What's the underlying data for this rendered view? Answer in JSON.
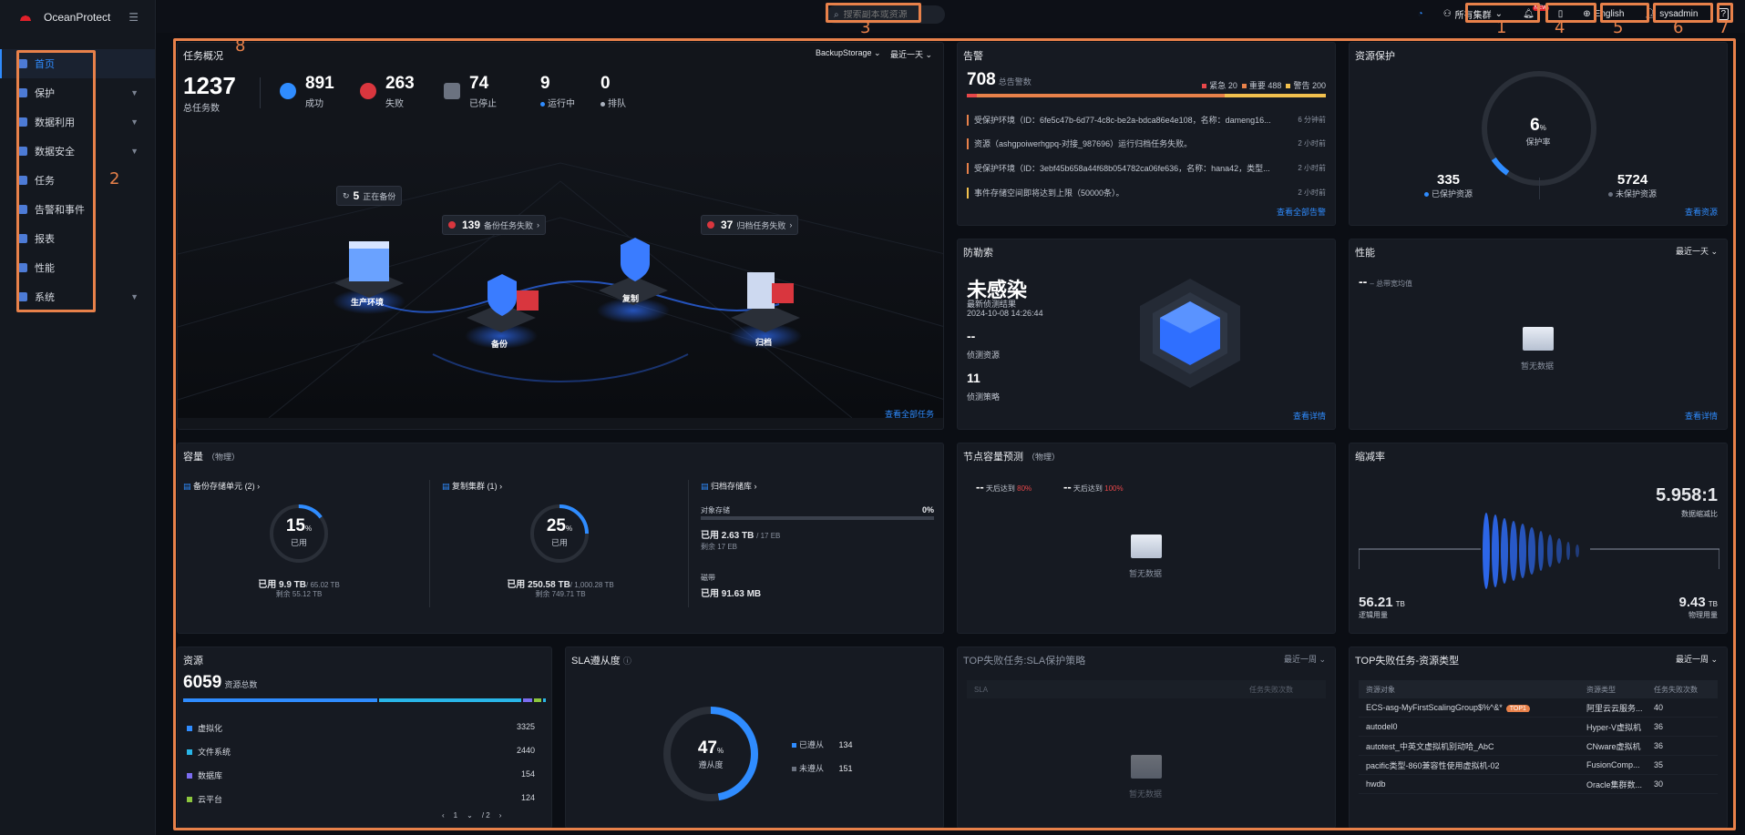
{
  "app": {
    "name": "OceanProtect"
  },
  "sidebar": {
    "items": [
      {
        "label": "首页",
        "active": true,
        "has_children": false
      },
      {
        "label": "保护",
        "has_children": true
      },
      {
        "label": "数据利用",
        "has_children": true
      },
      {
        "label": "数据安全",
        "has_children": true
      },
      {
        "label": "任务",
        "has_children": false
      },
      {
        "label": "告警和事件",
        "has_children": false
      },
      {
        "label": "报表",
        "has_children": false
      },
      {
        "label": "性能",
        "has_children": false
      },
      {
        "label": "系统",
        "has_children": true
      }
    ]
  },
  "topbar": {
    "search_placeholder": "搜索副本或资源",
    "cluster": "所有集群",
    "notify_badge": "NEW",
    "language": "English",
    "user": "sysadmin",
    "help": "?"
  },
  "annotations": {
    "n1": "1",
    "n2": "2",
    "n3": "3",
    "n4": "4",
    "n5": "5",
    "n6": "6",
    "n7": "7",
    "n8": "8"
  },
  "task_overview": {
    "title": "任务概况",
    "storage_select": "BackupStorage",
    "period_select": "最近一天",
    "total": "1237",
    "total_label": "总任务数",
    "success": "891",
    "success_label": "成功",
    "failed": "263",
    "failed_label": "失败",
    "stopped": "74",
    "stopped_label": "已停止",
    "running": "9",
    "running_label": "运行中",
    "queued": "0",
    "queued_label": "排队",
    "backing_up_count": "5",
    "backing_up_label": "正在备份",
    "backup_failed_count": "139",
    "backup_failed_label": "备份任务失败",
    "archive_failed_count": "37",
    "archive_failed_label": "归档任务失败",
    "scene_prod": "生产环境",
    "scene_backup": "备份",
    "scene_replica": "复制",
    "scene_archive": "归档",
    "view_all": "查看全部任务"
  },
  "alerts": {
    "title": "告警",
    "total": "708",
    "total_label": "总告警数",
    "critical_label": "紧急",
    "critical": "20",
    "major_label": "重要",
    "major": "488",
    "warning_label": "警告",
    "warning": "200",
    "rows": [
      {
        "text": "受保护环境（ID：6fe5c47b-6d77-4c8c-be2a-bdca86e4e108，名称：dameng16...",
        "time": "6 分钟前"
      },
      {
        "text": "资源（ashgpoiwerhgpq-对接_987696）运行归档任务失败。",
        "time": "2 小时前"
      },
      {
        "text": "受保护环境（ID：3ebf45b658a44f68b054782ca06fe636，名称：hana42，类型...",
        "time": "2 小时前"
      },
      {
        "text": "事件存储空间即将达到上限（50000条）。",
        "time": "2 小时前"
      }
    ],
    "view_all": "查看全部告警",
    "colors": {
      "critical": "#e8474a",
      "major": "#e8814a",
      "warning": "#f2c14e"
    }
  },
  "protection": {
    "title": "资源保护",
    "rate": "6",
    "rate_unit": "%",
    "rate_label": "保护率",
    "protected": "335",
    "protected_label": "已保护资源",
    "unprotected": "5724",
    "unprotected_label": "未保护资源",
    "view": "查看资源"
  },
  "ransomware": {
    "title": "防勒索",
    "status": "未感染",
    "latest_label": "最新侦测结果",
    "latest_time": "2024-10-08 14:26:44",
    "resources_value": "--",
    "resources_label": "侦测资源",
    "policies_value": "11",
    "policies_label": "侦测策略",
    "view": "查看详情"
  },
  "performance": {
    "title": "性能",
    "period": "最近一天",
    "value": "--",
    "value_label": "总带宽均值",
    "empty": "暂无数据",
    "view": "查看详情"
  },
  "capacity": {
    "title": "容量",
    "title_sub": "（物理）",
    "backup_unit_label": "备份存储单元",
    "backup_unit_count": "(2)",
    "backup_pct": "15",
    "backup_used_label": "已用",
    "backup_used": "9.9 TB",
    "backup_total": "/ 65.02 TB",
    "backup_remain": "剩余 55.12 TB",
    "replica_label": "复制集群",
    "replica_count": "(1)",
    "replica_pct": "25",
    "replica_used_label": "已用",
    "replica_used": "250.58 TB",
    "replica_total": "/ 1,000.28 TB",
    "replica_remain": "剩余 749.71 TB",
    "archive_label": "归档存储库",
    "object_storage_label": "对象存储",
    "object_storage_pct": "0%",
    "object_used": "2.63 TB",
    "object_total": "/ 17 EB",
    "object_remain": "剩余 17 EB",
    "tape_label": "磁带",
    "tape_used": "91.63 MB",
    "used_prefix": "已用",
    "pct_unit": "%"
  },
  "node_forecast": {
    "title": "节点容量预测",
    "title_sub": "（物理）",
    "a_value": "--",
    "a_text": "天后达到",
    "a_threshold": "80%",
    "b_value": "--",
    "b_text": "天后达到",
    "b_threshold": "100%",
    "empty": "暂无数据"
  },
  "reduction": {
    "title": "缩减率",
    "ratio": "5.958:1",
    "ratio_label": "数据缩减比",
    "logical": "56.21",
    "logical_unit": "TB",
    "logical_label": "逻辑用量",
    "physical": "9.43",
    "physical_unit": "TB",
    "physical_label": "物理用量"
  },
  "resources": {
    "title": "资源",
    "total": "6059",
    "total_label": "资源总数",
    "items": [
      {
        "label": "虚拟化",
        "value": "3325",
        "color": "#2f8cff"
      },
      {
        "label": "文件系统",
        "value": "2440",
        "color": "#29b6e8"
      },
      {
        "label": "数据库",
        "value": "154",
        "color": "#7b6cf0"
      },
      {
        "label": "云平台",
        "value": "124",
        "color": "#8cc63e"
      }
    ],
    "page": "1",
    "pages": "/ 2"
  },
  "sla": {
    "title": "SLA遵从度",
    "pct": "47",
    "pct_unit": "%",
    "pct_label": "遵从度",
    "compliant_label": "已遵从",
    "compliant": "134",
    "noncompliant_label": "未遵从",
    "noncompliant": "151"
  },
  "top_fail_sla": {
    "title": "TOP失败任务:SLA保护策略",
    "period": "最近一周",
    "col_sla": "SLA",
    "col_count": "任务失败次数",
    "empty": "暂无数据"
  },
  "top_fail_type": {
    "title": "TOP失败任务-资源类型",
    "period": "最近一周",
    "col_obj": "资源对象",
    "col_type": "资源类型",
    "col_count": "任务失败次数",
    "rows": [
      {
        "obj": "ECS-asg-MyFirstScalingGroup$%^&*",
        "tag": "TOP1",
        "type": "阿里云云服务...",
        "count": "40"
      },
      {
        "obj": "autodel0",
        "tag": "",
        "type": "Hyper-V虚拟机",
        "count": "36"
      },
      {
        "obj": "autotest_中英文虚拟机别动哈_AbC",
        "tag": "",
        "type": "CNware虚拟机",
        "count": "36"
      },
      {
        "obj": "pacific类型-860兼容性使用虚拟机-02",
        "tag": "",
        "type": "FusionComp...",
        "count": "35"
      },
      {
        "obj": "hwdb",
        "tag": "",
        "type": "Oracle集群数...",
        "count": "30"
      }
    ]
  }
}
